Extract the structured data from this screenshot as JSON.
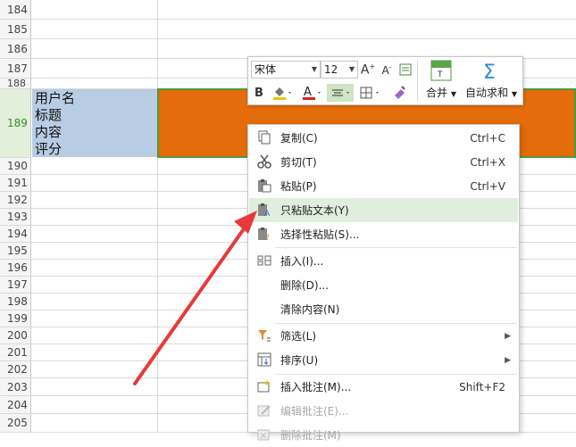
{
  "sheet": {
    "rows_before": [
      "184",
      "185",
      "186",
      "187",
      "188"
    ],
    "selected_row": "189",
    "rows_after": [
      "190",
      "191",
      "192",
      "193",
      "194",
      "195",
      "196",
      "197",
      "198",
      "199",
      "200",
      "201",
      "202",
      "203",
      "204",
      "205"
    ],
    "cell_a189_lines": [
      "用户名",
      "标题",
      "内容",
      "评分"
    ],
    "cell_a189_color": "#b8cce4",
    "cell_b189_color": "#e46c0a"
  },
  "mini_toolbar": {
    "font_name": "宋体",
    "font_size": "12",
    "grow_font": "A+",
    "shrink_font": "A-",
    "bold": "B",
    "merge_label": "合并",
    "autosum_label": "自动求和"
  },
  "context_menu": {
    "items": [
      {
        "label": "复制(C)",
        "shortcut": "Ctrl+C",
        "icon": "copy-icon"
      },
      {
        "label": "剪切(T)",
        "shortcut": "Ctrl+X",
        "icon": "scissors-icon"
      },
      {
        "label": "粘贴(P)",
        "shortcut": "Ctrl+V",
        "icon": "paste-icon"
      },
      {
        "label": "只粘贴文本(Y)",
        "shortcut": "",
        "icon": "paste-text-icon",
        "highlighted": true
      },
      {
        "label": "选择性粘贴(S)...",
        "shortcut": "",
        "icon": "paste-special-icon"
      },
      {
        "label": "插入(I)...",
        "shortcut": "",
        "icon": "insert-cells-icon"
      },
      {
        "label": "删除(D)...",
        "shortcut": "",
        "icon": ""
      },
      {
        "label": "清除内容(N)",
        "shortcut": "",
        "icon": ""
      },
      {
        "label": "筛选(L)",
        "shortcut": "",
        "icon": "filter-icon",
        "submenu": true
      },
      {
        "label": "排序(U)",
        "shortcut": "",
        "icon": "sort-icon",
        "submenu": true
      },
      {
        "label": "插入批注(M)...",
        "shortcut": "Shift+F2",
        "icon": "insert-comment-icon"
      },
      {
        "label": "编辑批注(E)...",
        "shortcut": "",
        "icon": "edit-comment-icon",
        "disabled": true
      },
      {
        "label": "删除批注(M)",
        "shortcut": "",
        "icon": "delete-comment-icon",
        "disabled": true
      }
    ],
    "highlight_color": "#dfeedd",
    "arrow_color": "#e8393a"
  }
}
